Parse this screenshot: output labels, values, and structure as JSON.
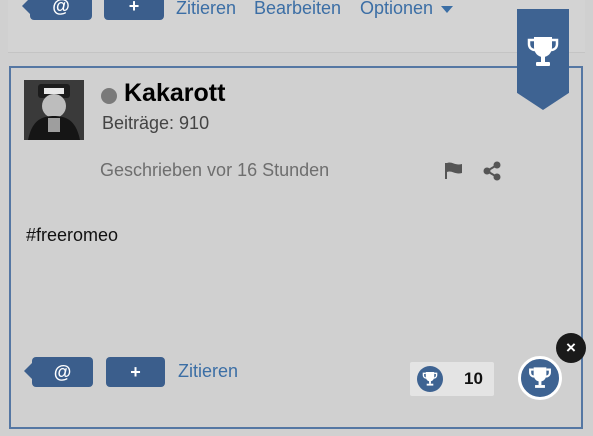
{
  "previous_post": {
    "mention_label": "@",
    "add_label": "+",
    "quote_label": "Zitieren",
    "edit_label": "Bearbeiten",
    "options_label": "Optionen"
  },
  "post": {
    "author": "Kakarott",
    "posts_count": "Beiträge: 910",
    "timestamp": "Geschrieben vor 16 Stunden",
    "content": "#freeromeo",
    "mention_label": "@",
    "add_label": "+",
    "quote_label": "Zitieren",
    "reaction_count": "10",
    "close_label": "×"
  },
  "icons": [
    "trophy-icon",
    "flag-icon",
    "share-icon",
    "close-icon"
  ],
  "colors": {
    "accent": "#3e6392",
    "link": "#3b6ea5",
    "status_offline": "#7a7a7a"
  }
}
